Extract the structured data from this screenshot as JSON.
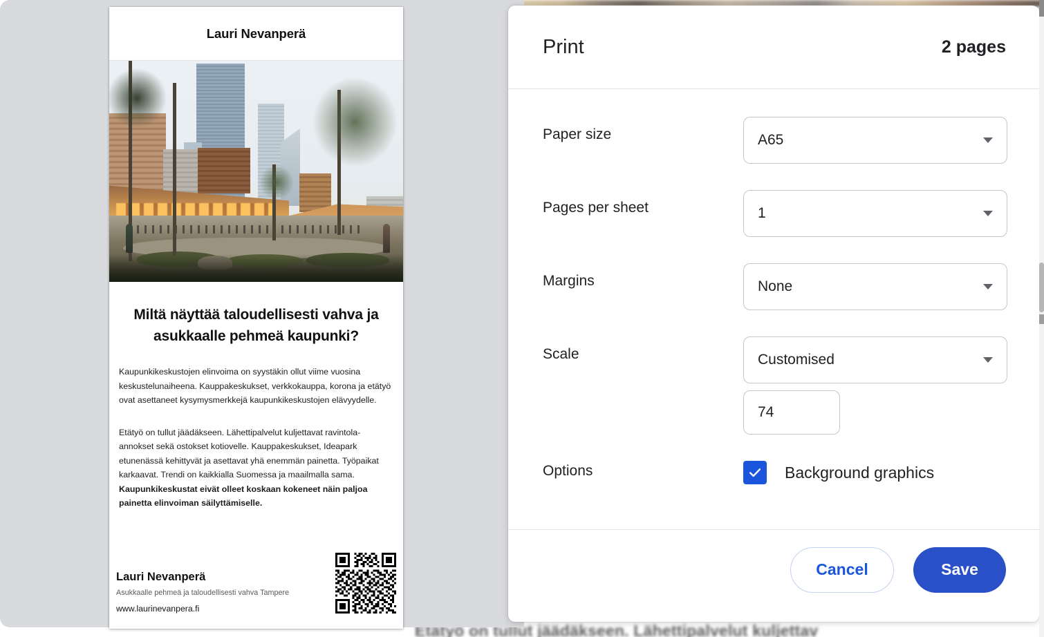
{
  "dialog": {
    "title": "Print",
    "pages_summary": "2 pages",
    "fields": [
      {
        "label": "Paper size",
        "value": "A65",
        "control": "select"
      },
      {
        "label": "Pages per sheet",
        "value": "1",
        "control": "select"
      },
      {
        "label": "Margins",
        "value": "None",
        "control": "select"
      },
      {
        "label": "Scale",
        "value": "Customised",
        "control": "select",
        "extra_value": "74"
      },
      {
        "label": "Options",
        "value": "Background graphics",
        "control": "checkbox",
        "checked": true
      }
    ],
    "buttons": {
      "cancel": "Cancel",
      "save": "Save"
    },
    "colors": {
      "accent": "#2a50c8",
      "link": "#1a56db",
      "checkbox": "#1a56db",
      "border": "#c6c7c9"
    }
  },
  "preview": {
    "page_count_shown": 1,
    "document": {
      "header_brand": "Lauri Nevanperä",
      "hero_image_alt": "Architectural rendering of a city square with wooden arcades and high-rise towers",
      "headline": "Miltä näyttää taloudellisesti vahva ja asukkaalle pehmeä kaupunki?",
      "paragraph_1": "Kaupunkikeskustojen elinvoima on syystäkin ollut viime vuosina keskustelunaiheena. Kauppakeskukset, verkkokauppa, korona ja etätyö ovat asettaneet kysymysmerkkejä kaupunkikeskustojen elävyydelle.",
      "paragraph_2_plain": "Etätyö on tullut jäädäkseen. Lähettipalvelut kuljettavat ravintola-annokset sekä ostokset kotiovelle. Kauppakeskukset, Ideapark etunenässä kehittyvät ja asettavat yhä enemmän painetta. Työpaikat karkaavat. Trendi on kaikkialla Suomessa ja maailmalla sama. ",
      "paragraph_2_bold": "Kaupunkikeskustat eivät olleet koskaan kokeneet näin paljoa painetta elinvoiman säilyttämiselle.",
      "footer_name": "Lauri Nevanperä",
      "footer_tagline": "Asukkaalle pehmeä ja taloudellisesti vahva Tampere",
      "footer_url": "www.laurinevanpera.fi",
      "qr_code_alt": "qr-code"
    }
  },
  "background_page": {
    "blurred_text": "Etätyö on tullut jäädäkseen. Lähettipalvelut kuljettav"
  }
}
